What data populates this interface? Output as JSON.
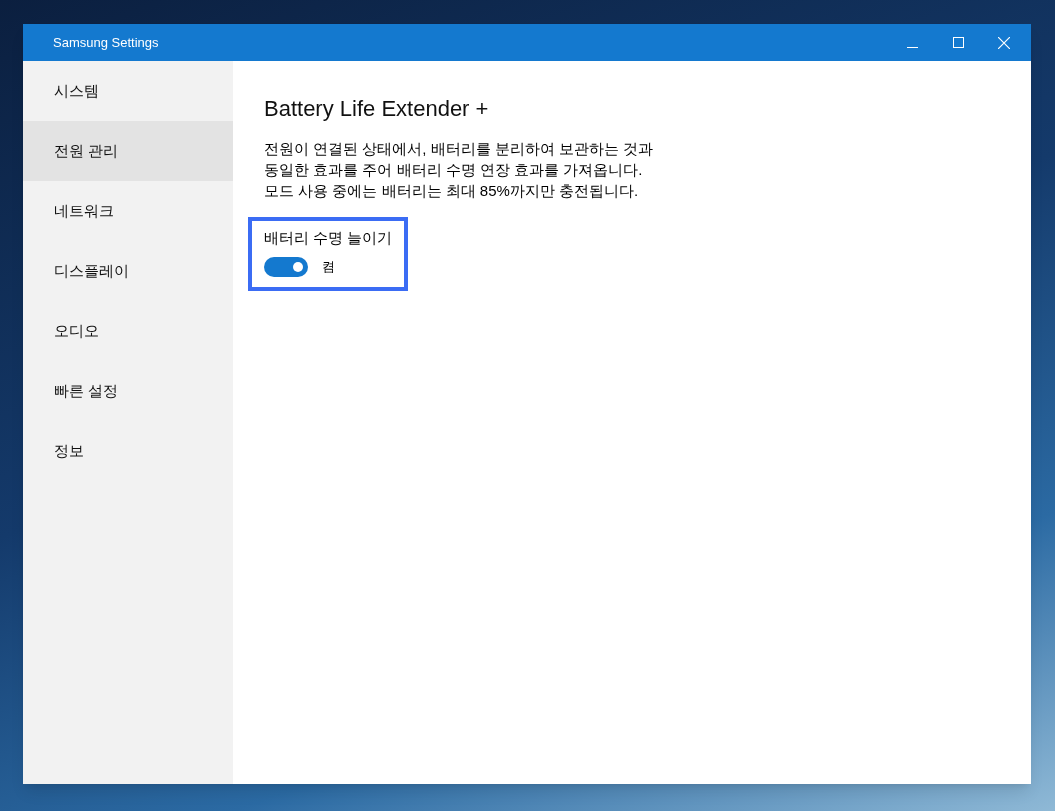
{
  "window": {
    "title": "Samsung Settings"
  },
  "sidebar": {
    "items": [
      {
        "label": "시스템",
        "selected": false
      },
      {
        "label": "전원 관리",
        "selected": true
      },
      {
        "label": "네트워크",
        "selected": false
      },
      {
        "label": "디스플레이",
        "selected": false
      },
      {
        "label": "오디오",
        "selected": false
      },
      {
        "label": "빠른 설정",
        "selected": false
      },
      {
        "label": "정보",
        "selected": false
      }
    ]
  },
  "content": {
    "title": "Battery Life Extender +",
    "description": [
      "전원이 연결된 상태에서, 배터리를 분리하여 보관하는 것과",
      "동일한 효과를 주어 배터리 수명 연장 효과를 가져옵니다.",
      "모드 사용 중에는 배터리는 최대 85%까지만 충전됩니다."
    ],
    "setting": {
      "label": "배터리 수명 늘이기",
      "kind": "toggle",
      "on": true,
      "state_text": "켬",
      "highlighted": true
    }
  }
}
